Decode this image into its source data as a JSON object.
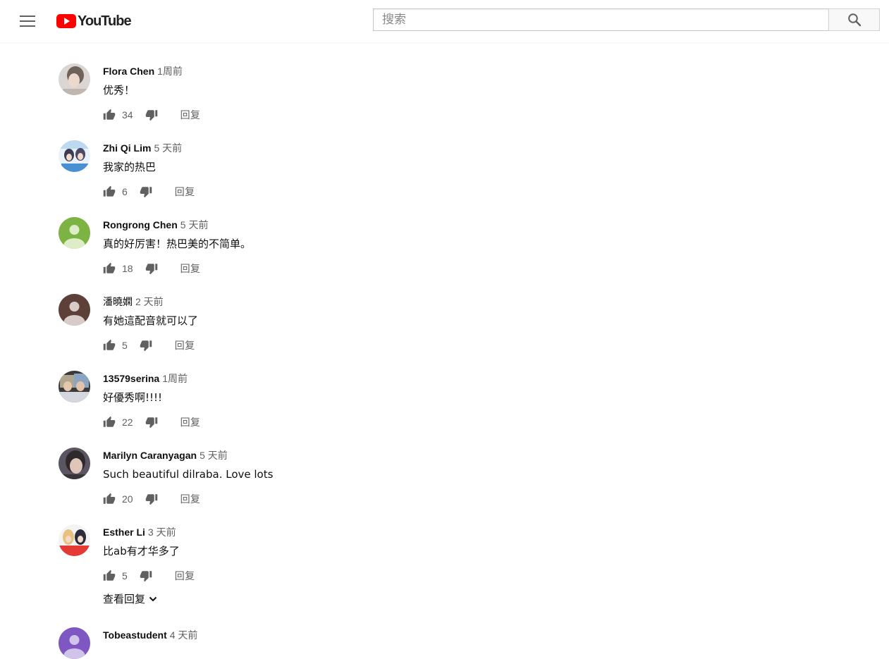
{
  "header": {
    "logo_text": "YouTube",
    "search_placeholder": "搜索"
  },
  "reply_label": "回复",
  "comments": [
    {
      "author": "Flora Chen",
      "time": "1周前",
      "text": "优秀！",
      "likes": "34"
    },
    {
      "author": "Zhi Qi Lim",
      "time": "5 天前",
      "text": "我家的热巴",
      "likes": "6"
    },
    {
      "author": "Rongrong Chen",
      "time": "5 天前",
      "text": "真的好厉害！热巴美的不简单。",
      "likes": "18"
    },
    {
      "author": "潘曉嫻",
      "time": "2 天前",
      "text": "有她這配音就可以了",
      "likes": "5"
    },
    {
      "author": "13579serina",
      "time": "1周前",
      "text": "好優秀啊!!!!",
      "likes": "22"
    },
    {
      "author": "Marilyn Caranyagan",
      "time": "5 天前",
      "text": "Such beautiful dilraba. Love lots",
      "likes": "20"
    },
    {
      "author": "Esther Li",
      "time": "3 天前",
      "text": "比ab有才华多了",
      "likes": "5",
      "view_replies": "查看回复"
    },
    {
      "author": "Tobeastudent",
      "time": "4 天前",
      "text": "",
      "likes": ""
    }
  ],
  "colors": {
    "brand_red": "#ff0000",
    "avatar_green": "#7cb342",
    "avatar_brown": "#5d4037",
    "avatar_purple": "#7e57c2"
  }
}
